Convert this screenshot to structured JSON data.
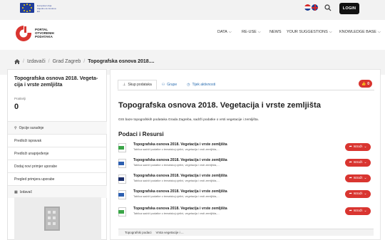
{
  "topbar": {
    "eu_text": "Europska Unija Zajedno do fondova EU",
    "login_label": "LOGIN"
  },
  "header": {
    "logo_lines": [
      "PORTAL",
      "OTVORENIH",
      "PODATAKA"
    ],
    "nav": [
      {
        "label": "DATA",
        "dropdown": true
      },
      {
        "label": "RE-USE",
        "dropdown": true
      },
      {
        "label": "NEWS",
        "dropdown": false
      },
      {
        "label": "YOUR SUGGESTIONS",
        "dropdown": true
      },
      {
        "label": "KNOWLEDGE BASE",
        "dropdown": true
      }
    ]
  },
  "breadcrumb": {
    "items": [
      "Izdavači",
      "Grad Zagreb",
      "Topografska osnova 2018...."
    ]
  },
  "sidebar": {
    "title": "Topografska osnova 2018. Vegeta-cija i vrste zemljišta",
    "followers_label": "Pratitelji",
    "followers_value": "0",
    "options_header": "Opcije suradnje",
    "options": [
      "Predloži ispravak",
      "Predloži unaprjeđenje",
      "Dodaj novi primjer uporabe",
      "Pregled primjera uporabe"
    ],
    "publisher_header": "Izdavač"
  },
  "tabs": [
    {
      "label": "Skup podataka",
      "icon": "sitemap-icon",
      "active": true
    },
    {
      "label": "Grupe",
      "icon": "users-icon",
      "active": false
    },
    {
      "label": "Tijek aktivnosti",
      "icon": "clock-icon",
      "active": false
    }
  ],
  "like": {
    "count": "0",
    "icon": "thumbs-up-icon"
  },
  "dataset": {
    "title": "Topografska osnova 2018. Vegetacija i vrste zemljišta",
    "description": "GIS baze topografskih podataka Grada Zagreba, sadrži podatke o vrsti vegetacije i zemljišta.",
    "resources_title": "Podaci i Resursi"
  },
  "resources": [
    {
      "title": "Topografska osnova 2018. Vegetacija i vrste zemljišta",
      "desc": "Tablica sadrži podatke o tematskoj cjelini, vegetacija i vrsti zemljišta,...",
      "icon": "green-format-icon",
      "color": "#3aa547"
    },
    {
      "title": "Topografska osnova 2018. Vegetacija i vrste zemljišta",
      "desc": "Tablica sadrži podatke o tematskoj cjelini, vegetacija i vrsti zemljišta,...",
      "icon": "blue-format-icon",
      "color": "#2d5fb0"
    },
    {
      "title": "Topografska osnova 2018. Vegetacija i vrste zemljišta",
      "desc": "Tablica sadrži podatke o tematskoj cjelini, vegetacija i vrsti zemljišta,...",
      "icon": "navy-format-icon",
      "color": "#1c2f6b"
    },
    {
      "title": "Topografska osnova 2018. Vegetacija i vrste zemljišta",
      "desc": "Tablica sadrži podatke o tematskoj cjelini, vegetacija i vrsti zemljišta,...",
      "icon": "blue-format-icon",
      "color": "#2d5fb0"
    },
    {
      "title": "Topografska osnova 2018. Vegetacija i vrste zemljišta",
      "desc": "Tablica sadrži podatke o tematskoj cjelini, vegetacija i vrsti zemljišta,...",
      "icon": "green-format-icon",
      "color": "#3aa547"
    }
  ],
  "explore_label": "Istraži",
  "table_head": [
    "Topografski podaci",
    "Vrsta vegetacije i ..."
  ],
  "colors": {
    "accent": "#d93530",
    "link": "#2a6db0"
  }
}
